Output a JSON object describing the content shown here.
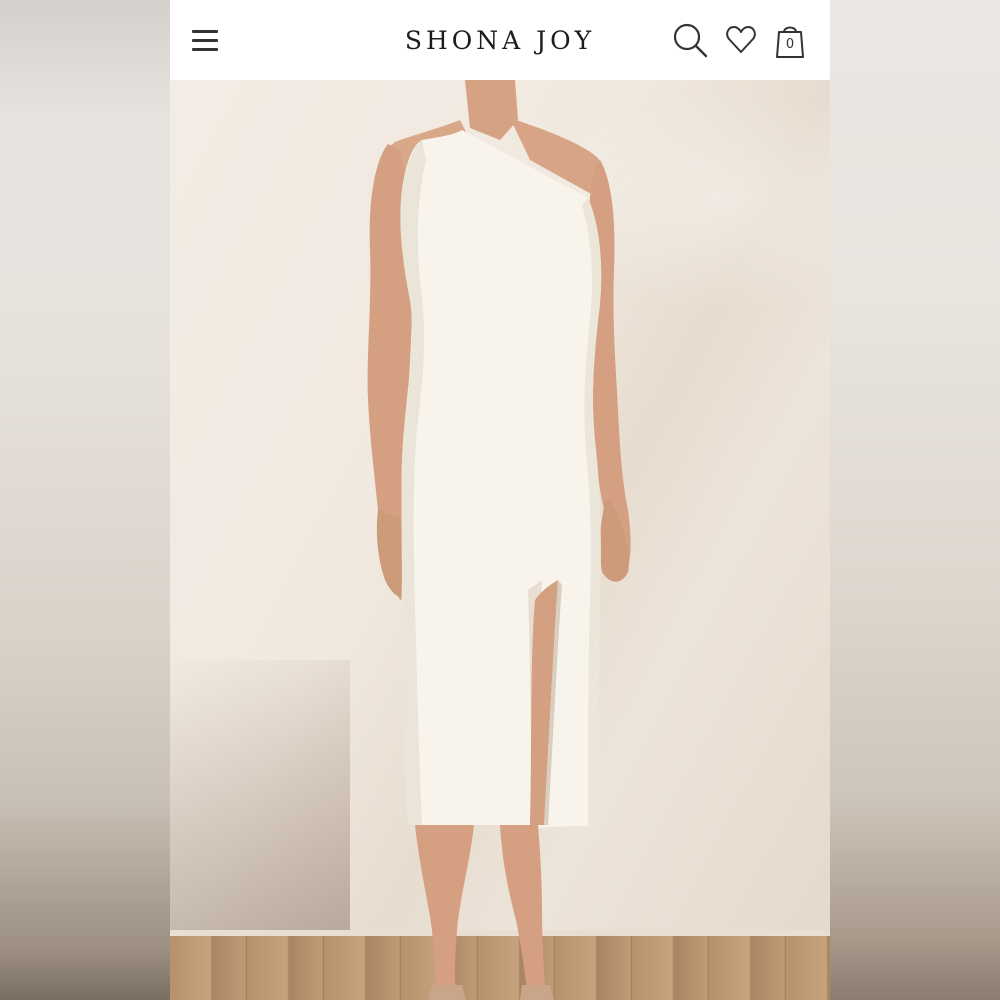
{
  "header": {
    "logo_text": "SHONA JOY",
    "cart_count": "0"
  },
  "icons": {
    "menu": "hamburger-menu-icon",
    "search": "search-icon",
    "wishlist": "heart-icon",
    "cart": "shopping-bag-icon"
  },
  "colors": {
    "header_bg": "#ffffff",
    "wall": "#efe6dc",
    "dress": "#f8f4ec",
    "skin": "#d9a888",
    "floor": "#b7916c"
  }
}
